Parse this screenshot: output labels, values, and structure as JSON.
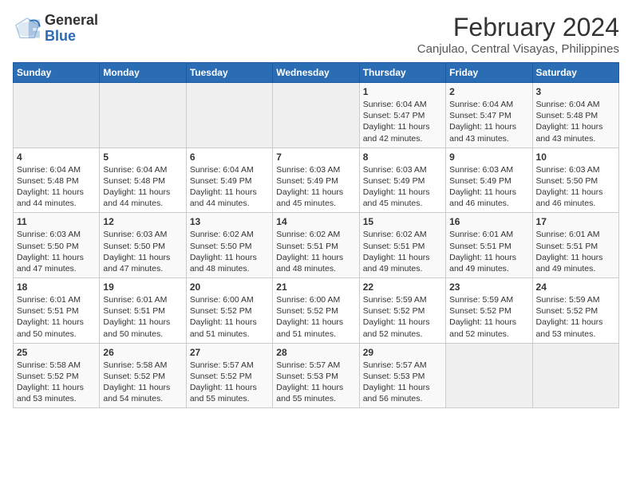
{
  "logo": {
    "general": "General",
    "blue": "Blue"
  },
  "title": "February 2024",
  "subtitle": "Canjulao, Central Visayas, Philippines",
  "days_of_week": [
    "Sunday",
    "Monday",
    "Tuesday",
    "Wednesday",
    "Thursday",
    "Friday",
    "Saturday"
  ],
  "weeks": [
    [
      {
        "day": "",
        "empty": true
      },
      {
        "day": "",
        "empty": true
      },
      {
        "day": "",
        "empty": true
      },
      {
        "day": "",
        "empty": true
      },
      {
        "day": "1",
        "sunrise": "6:04 AM",
        "sunset": "5:47 PM",
        "daylight": "11 hours and 42 minutes."
      },
      {
        "day": "2",
        "sunrise": "6:04 AM",
        "sunset": "5:47 PM",
        "daylight": "11 hours and 43 minutes."
      },
      {
        "day": "3",
        "sunrise": "6:04 AM",
        "sunset": "5:48 PM",
        "daylight": "11 hours and 43 minutes."
      }
    ],
    [
      {
        "day": "4",
        "sunrise": "6:04 AM",
        "sunset": "5:48 PM",
        "daylight": "11 hours and 44 minutes."
      },
      {
        "day": "5",
        "sunrise": "6:04 AM",
        "sunset": "5:48 PM",
        "daylight": "11 hours and 44 minutes."
      },
      {
        "day": "6",
        "sunrise": "6:04 AM",
        "sunset": "5:49 PM",
        "daylight": "11 hours and 44 minutes."
      },
      {
        "day": "7",
        "sunrise": "6:03 AM",
        "sunset": "5:49 PM",
        "daylight": "11 hours and 45 minutes."
      },
      {
        "day": "8",
        "sunrise": "6:03 AM",
        "sunset": "5:49 PM",
        "daylight": "11 hours and 45 minutes."
      },
      {
        "day": "9",
        "sunrise": "6:03 AM",
        "sunset": "5:49 PM",
        "daylight": "11 hours and 46 minutes."
      },
      {
        "day": "10",
        "sunrise": "6:03 AM",
        "sunset": "5:50 PM",
        "daylight": "11 hours and 46 minutes."
      }
    ],
    [
      {
        "day": "11",
        "sunrise": "6:03 AM",
        "sunset": "5:50 PM",
        "daylight": "11 hours and 47 minutes."
      },
      {
        "day": "12",
        "sunrise": "6:03 AM",
        "sunset": "5:50 PM",
        "daylight": "11 hours and 47 minutes."
      },
      {
        "day": "13",
        "sunrise": "6:02 AM",
        "sunset": "5:50 PM",
        "daylight": "11 hours and 48 minutes."
      },
      {
        "day": "14",
        "sunrise": "6:02 AM",
        "sunset": "5:51 PM",
        "daylight": "11 hours and 48 minutes."
      },
      {
        "day": "15",
        "sunrise": "6:02 AM",
        "sunset": "5:51 PM",
        "daylight": "11 hours and 49 minutes."
      },
      {
        "day": "16",
        "sunrise": "6:01 AM",
        "sunset": "5:51 PM",
        "daylight": "11 hours and 49 minutes."
      },
      {
        "day": "17",
        "sunrise": "6:01 AM",
        "sunset": "5:51 PM",
        "daylight": "11 hours and 49 minutes."
      }
    ],
    [
      {
        "day": "18",
        "sunrise": "6:01 AM",
        "sunset": "5:51 PM",
        "daylight": "11 hours and 50 minutes."
      },
      {
        "day": "19",
        "sunrise": "6:01 AM",
        "sunset": "5:51 PM",
        "daylight": "11 hours and 50 minutes."
      },
      {
        "day": "20",
        "sunrise": "6:00 AM",
        "sunset": "5:52 PM",
        "daylight": "11 hours and 51 minutes."
      },
      {
        "day": "21",
        "sunrise": "6:00 AM",
        "sunset": "5:52 PM",
        "daylight": "11 hours and 51 minutes."
      },
      {
        "day": "22",
        "sunrise": "5:59 AM",
        "sunset": "5:52 PM",
        "daylight": "11 hours and 52 minutes."
      },
      {
        "day": "23",
        "sunrise": "5:59 AM",
        "sunset": "5:52 PM",
        "daylight": "11 hours and 52 minutes."
      },
      {
        "day": "24",
        "sunrise": "5:59 AM",
        "sunset": "5:52 PM",
        "daylight": "11 hours and 53 minutes."
      }
    ],
    [
      {
        "day": "25",
        "sunrise": "5:58 AM",
        "sunset": "5:52 PM",
        "daylight": "11 hours and 53 minutes."
      },
      {
        "day": "26",
        "sunrise": "5:58 AM",
        "sunset": "5:52 PM",
        "daylight": "11 hours and 54 minutes."
      },
      {
        "day": "27",
        "sunrise": "5:57 AM",
        "sunset": "5:52 PM",
        "daylight": "11 hours and 55 minutes."
      },
      {
        "day": "28",
        "sunrise": "5:57 AM",
        "sunset": "5:53 PM",
        "daylight": "11 hours and 55 minutes."
      },
      {
        "day": "29",
        "sunrise": "5:57 AM",
        "sunset": "5:53 PM",
        "daylight": "11 hours and 56 minutes."
      },
      {
        "day": "",
        "empty": true
      },
      {
        "day": "",
        "empty": true
      }
    ]
  ]
}
